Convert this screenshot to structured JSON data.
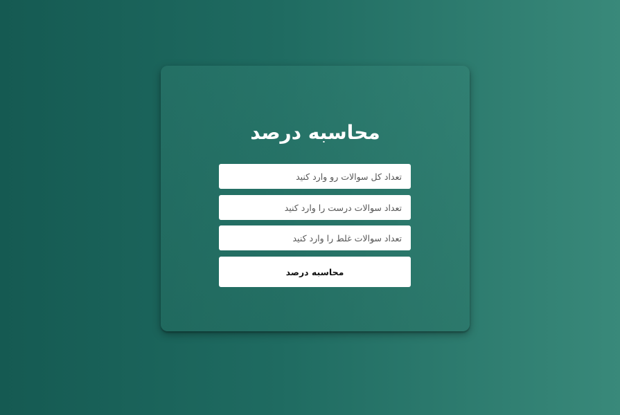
{
  "form": {
    "title": "محاسبه درصد",
    "total_questions": {
      "value": "",
      "placeholder": "تعداد کل سوالات رو وارد کنید"
    },
    "correct_questions": {
      "value": "",
      "placeholder": "تعداد سوالات درست را وارد کنید"
    },
    "wrong_questions": {
      "value": "",
      "placeholder": "تعداد سوالات غلط را وارد کنید"
    },
    "calculate_label": "محاسبه درصد"
  },
  "colors": {
    "background_start": "#155a52",
    "background_end": "#39897a",
    "field_background": "#ffffff",
    "title_color": "#ffffff"
  }
}
